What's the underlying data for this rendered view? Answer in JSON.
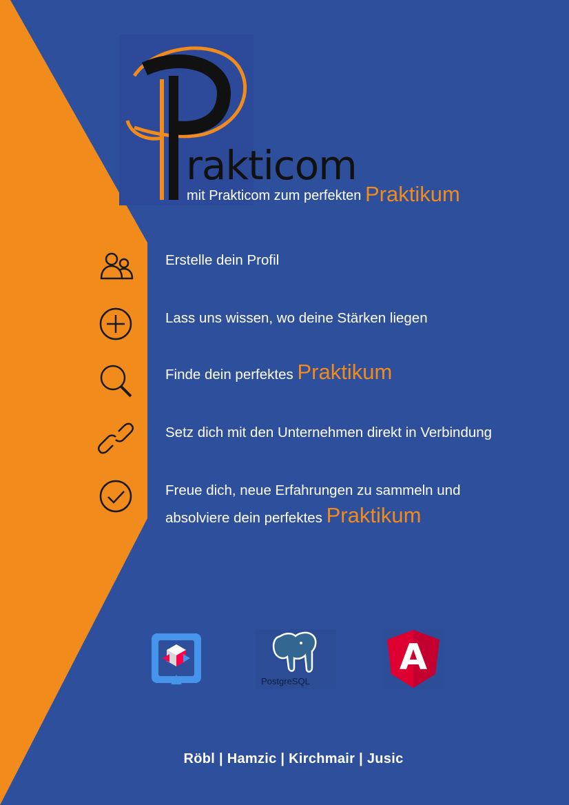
{
  "brand": {
    "logo_letter": "P",
    "name": "rakticom",
    "tagline_prefix": "mit Prakticom zum perfekten",
    "tagline_highlight": "Praktikum"
  },
  "steps": [
    {
      "icon": "users-icon",
      "text": "Erstelle dein Profil"
    },
    {
      "icon": "plus-circle-icon",
      "text": "Lass uns wissen, wo deine Stärken liegen"
    },
    {
      "icon": "search-icon",
      "text_prefix": "Finde dein perfektes",
      "highlight": "Praktikum"
    },
    {
      "icon": "link-icon",
      "text": "Setz dich mit den Unternehmen direkt in Verbindung"
    },
    {
      "icon": "check-circle-icon",
      "line1": "Freue dich, neue Erfahrungen zu sammeln und",
      "line2_prefix": "absolviere dein perfektes",
      "highlight": "Praktikum"
    }
  ],
  "tech": [
    {
      "icon": "quarkus-logo-icon"
    },
    {
      "icon": "postgresql-logo-icon",
      "label": "PostgreSQL"
    },
    {
      "icon": "angular-logo-icon",
      "label": "A"
    }
  ],
  "footer": {
    "names": "Röbl | Hamzic | Kirchmair | Jusic"
  },
  "colors": {
    "background": "#2e4f9c",
    "accent": "#f18b1c",
    "text": "#ffffff",
    "logo_dark": "#111111"
  }
}
